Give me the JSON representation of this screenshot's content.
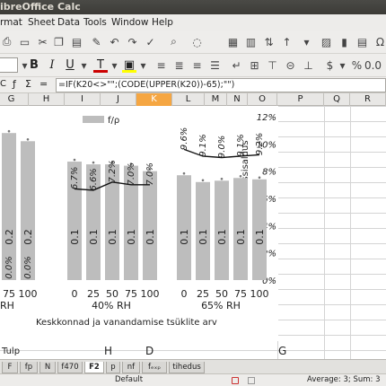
{
  "window": {
    "title": "ibreOffice Calc"
  },
  "menu": [
    "rmat",
    "Sheet",
    "Data",
    "Tools",
    "Window",
    "Help"
  ],
  "formula": {
    "cell_ref": "C",
    "text": "=IF(K20<>\"\";(CODE(UPPER(K20))-65);\"\")"
  },
  "columns": [
    "G",
    "H",
    "I",
    "J",
    "K",
    "L",
    "M",
    "N",
    "O",
    "P",
    "Q",
    "R"
  ],
  "sheet_cells": {
    "tulp": "Tulp",
    "h": "H",
    "d": "D",
    "g": "G"
  },
  "tabs": [
    "F",
    "fp",
    "N",
    "f470",
    "F2",
    "p",
    "nf",
    "fₑₓₚ",
    "tihedus"
  ],
  "active_tab": "F2",
  "status": {
    "style": "Default",
    "summary": "Average: 3; Sum: 3"
  },
  "colors": {
    "bar": "#bdbdbd",
    "line": "#111111",
    "selected_column": "#f5a642"
  },
  "chart_data": {
    "type": "bar",
    "legend": "f/ρ",
    "ylabel": "Katsekeha niiskussisaldus",
    "xlabel": "Keskkonnad ja vanandamise tsüklite arv",
    "right_ticks": [
      "0%",
      "2%",
      "4%",
      "6%",
      "8%",
      "10%",
      "12%"
    ],
    "ylim": [
      0,
      12
    ],
    "groups": [
      {
        "label": "RH",
        "categories": [
          "75",
          "100"
        ],
        "bar_labels": [
          "0.2",
          "0.2"
        ],
        "moisture_labels": [
          "0.0%",
          "0.0%"
        ],
        "moisture": [
          0.0,
          0.0
        ],
        "heights": [
          10.8,
          10.2
        ]
      },
      {
        "label": "40% RH",
        "categories": [
          "0",
          "25",
          "50",
          "75",
          "100"
        ],
        "bar_labels": [
          "0.1",
          "0.1",
          "0.1",
          "0.1",
          "0.1"
        ],
        "moisture_labels": [
          "6.7%",
          "6.6%",
          "7.2%",
          "7.0%",
          "7.0%"
        ],
        "moisture": [
          6.7,
          6.6,
          7.2,
          7.0,
          7.0
        ],
        "heights": [
          8.7,
          8.5,
          8.5,
          8.4,
          8.0
        ]
      },
      {
        "label": "65% RH",
        "categories": [
          "0",
          "25",
          "50",
          "75",
          "100"
        ],
        "bar_labels": [
          "0.1",
          "0.1",
          "0.1",
          "0.1",
          "0.1"
        ],
        "moisture_labels": [
          "9.6%",
          "9.1%",
          "9.0%",
          "9.1%",
          "9.2%"
        ],
        "moisture": [
          9.6,
          9.1,
          9.0,
          9.1,
          9.2
        ],
        "heights": [
          7.7,
          7.2,
          7.3,
          7.5,
          7.4
        ]
      }
    ]
  }
}
